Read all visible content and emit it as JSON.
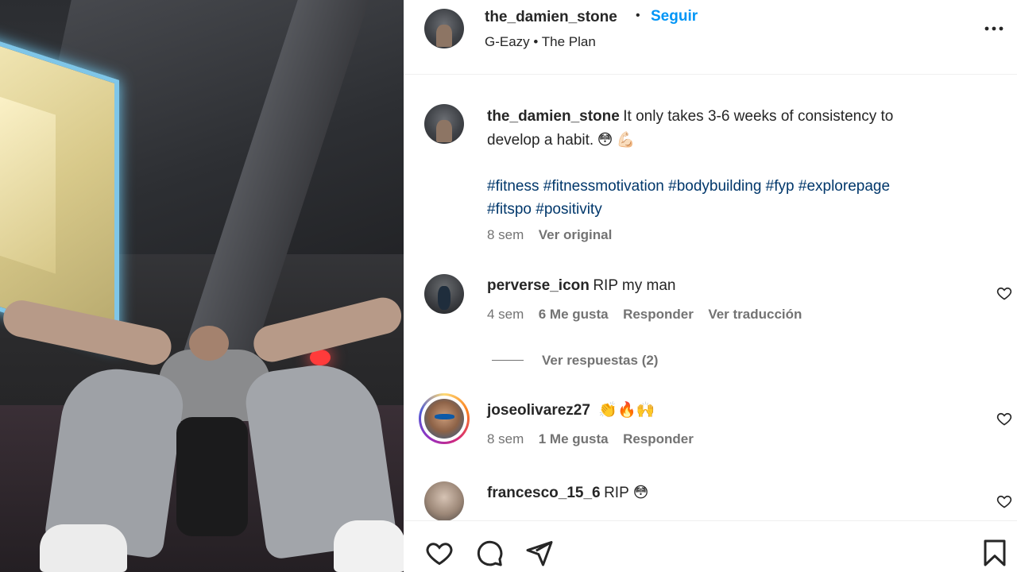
{
  "header": {
    "username": "the_damien_stone",
    "separator": "•",
    "follow_label": "Seguir",
    "audio": "G-Eazy • The Plan",
    "more_icon": "more-horizontal-icon"
  },
  "caption": {
    "username": "the_damien_stone",
    "text_line1": "It only takes 3-6 weeks of consistency to",
    "text_line2": "develop a habit.",
    "emoji1": "😳",
    "emoji2": "💪🏻",
    "hashtags_line1": [
      "#fitness",
      "#fitnessmotivation",
      "#bodybuilding",
      "#fyp",
      "#explorepage"
    ],
    "hashtags_line2": [
      "#fitspo",
      "#positivity"
    ],
    "time": "8 sem",
    "see_original": "Ver original"
  },
  "comments": [
    {
      "username": "perverse_icon",
      "text": "RIP my man",
      "time": "4 sem",
      "likes": "6 Me gusta",
      "reply": "Responder",
      "translate": "Ver traducción",
      "view_replies": "Ver respuestas (2)"
    },
    {
      "username": "joseolivarez27",
      "text": "👏🔥🙌",
      "time": "8 sem",
      "likes": "1 Me gusta",
      "reply": "Responder"
    },
    {
      "username": "francesco_15_6",
      "text": "RIP 😳",
      "time": "",
      "reply": ""
    }
  ],
  "actions": {
    "like_icon": "heart-icon",
    "comment_icon": "comment-icon",
    "share_icon": "send-icon",
    "save_icon": "bookmark-icon"
  },
  "colors": {
    "follow": "#0095f6",
    "hashtag": "#00376b",
    "meta": "#737373"
  }
}
